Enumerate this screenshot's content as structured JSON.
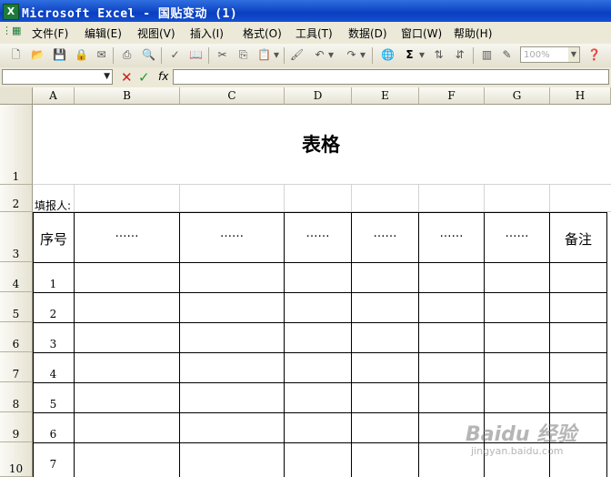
{
  "window": {
    "title": "Microsoft Excel - 国贴变动 (1)",
    "app_icon": "X"
  },
  "menu": [
    "文件(F)",
    "编辑(E)",
    "视图(V)",
    "插入(I)",
    "格式(O)",
    "工具(T)",
    "数据(D)",
    "窗口(W)",
    "帮助(H)"
  ],
  "toolbar": {
    "icons": [
      "new-icon",
      "open-icon",
      "save-icon",
      "permission-icon",
      "mail-icon",
      "print-icon",
      "print-preview-icon",
      "spelling-icon",
      "research-icon",
      "cut-icon",
      "copy-icon",
      "paste-icon",
      "undo-icon",
      "redo-icon",
      "hyperlink-icon",
      "autosum-icon",
      "sort-asc-icon",
      "sort-desc-icon",
      "chart-wizard-icon",
      "drawing-icon",
      "help-icon"
    ],
    "zoom": "100%"
  },
  "formula_bar": {
    "name_box": "",
    "cancel_glyph": "✕",
    "enter_glyph": "✓",
    "fx_label": "fx",
    "content": ""
  },
  "columns": [
    "A",
    "B",
    "C",
    "D",
    "E",
    "F",
    "G",
    "H"
  ],
  "rows": [
    "1",
    "2",
    "3",
    "4",
    "5",
    "6",
    "7",
    "8",
    "9",
    "10"
  ],
  "sheet": {
    "title": "表格",
    "filler_label": "填报人:",
    "headers": {
      "seq": "序号",
      "b": "……",
      "c": "……",
      "d": "……",
      "e": "……",
      "f": "……",
      "g": "……",
      "note": "备注"
    },
    "serials": [
      "1",
      "2",
      "3",
      "4",
      "5",
      "6",
      "7"
    ]
  },
  "watermark": {
    "brand": "Baidu 经验",
    "url": "jingyan.baidu.com"
  }
}
